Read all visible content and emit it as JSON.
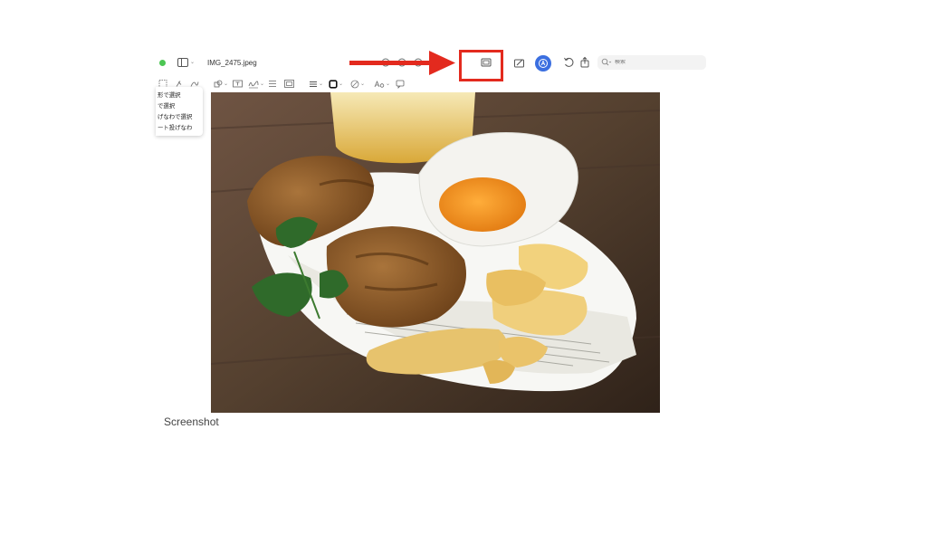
{
  "window": {
    "title": "IMG_2475.jpeg",
    "search_placeholder": "検索"
  },
  "selection_menu": {
    "items": [
      "形で選択",
      "で選択",
      "げなわで選択",
      "ート投げなわ"
    ]
  },
  "caption": "Screenshot",
  "colors": {
    "highlight": "#e32a1e",
    "markup_button": "#3b6fe0",
    "traffic_green": "#4cc653"
  },
  "icons": {
    "toolbar": [
      "sidebar-icon",
      "zoom-out-icon",
      "zoom-in-icon",
      "zoom-fit-icon",
      "thumbnail-icon",
      "highlight-pen-icon",
      "markup-icon",
      "rotate-icon",
      "share-icon",
      "search-icon"
    ]
  }
}
